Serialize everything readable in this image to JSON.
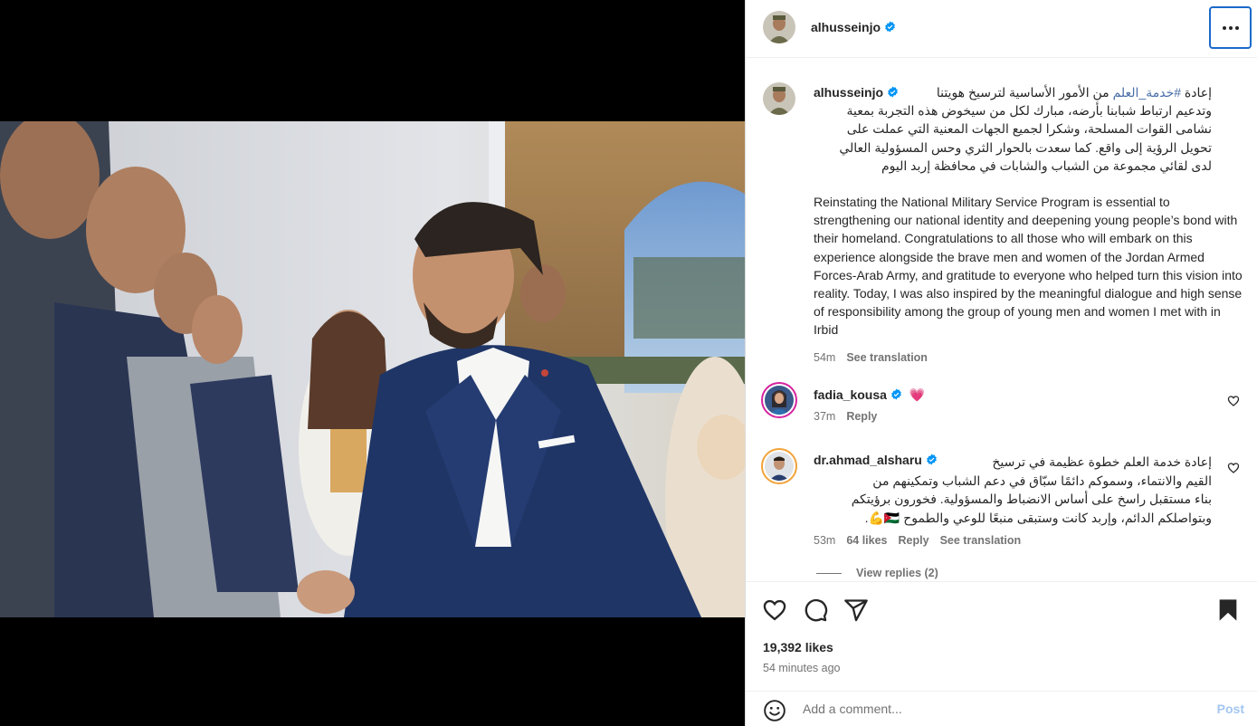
{
  "post": {
    "author": "alhusseinjo",
    "caption_hashtag": "#خدمة_العلم",
    "caption_ar_line1_before": "إعادة",
    "caption_ar_line1_after": "من الأمور الأساسية لترسيخ هويتنا",
    "caption_ar_lines": [
      "وتدعيم ارتباط شبابنا بأرضه، مبارك لكل من سيخوض هذه التجربة بمعية",
      "نشامى القوات المسلحة، وشكرا لجميع الجهات المعنية التي عملت على",
      "تحويل الرؤية إلى واقع. كما سعدت بالحوار الثري وحس المسؤولية العالي",
      "لدى لقائي مجموعة من الشباب والشابات في محافظة إربد اليوم"
    ],
    "caption_en": "Reinstating the National Military Service Program is essential to strengthening our national identity and deepening young people’s bond with their homeland. Congratulations to all those who will embark on this experience alongside the brave men and women of the Jordan Armed Forces-Arab Army, and gratitude to everyone who helped turn this vision into reality. Today, I was also inspired by the meaningful dialogue and high sense of responsibility among the group of young men and women I met with in Irbid",
    "caption_time": "54m",
    "see_translation": "See translation",
    "likes": "19,392 likes",
    "time_ago": "54 minutes ago"
  },
  "comments": [
    {
      "username": "fadia_kousa",
      "emoji": "💗",
      "time": "37m",
      "reply": "Reply"
    },
    {
      "username": "dr.ahmad_alsharu",
      "lines": [
        "إعادة خدمة العلم خطوة عظيمة في ترسيخ",
        "القيم والانتماء، وسموكم دائمًا سبّاق في دعم الشباب وتمكينهم من",
        "بناء مستقبل راسخ على أساس الانضباط والمسؤولية. فخورون برؤيتكم",
        "وبتواصلكم الدائم، وإربد كانت وستبقى منبعًا للوعي والطموح 🇯🇴💪."
      ],
      "time": "53m",
      "likes": "64 likes",
      "reply": "Reply",
      "see_translation": "See translation",
      "view_replies": "View replies (2)"
    }
  ],
  "composer": {
    "placeholder": "Add a comment...",
    "post_label": "Post"
  },
  "colors": {
    "link": "#4a6ea9",
    "verified": "#0095f6",
    "post_button": "#a3c6f2",
    "focus_outline": "#1b6ac9"
  },
  "icons": [
    "more-icon",
    "verified-icon",
    "heart-icon",
    "comment-icon",
    "share-icon",
    "bookmark-icon",
    "emoji-icon"
  ]
}
